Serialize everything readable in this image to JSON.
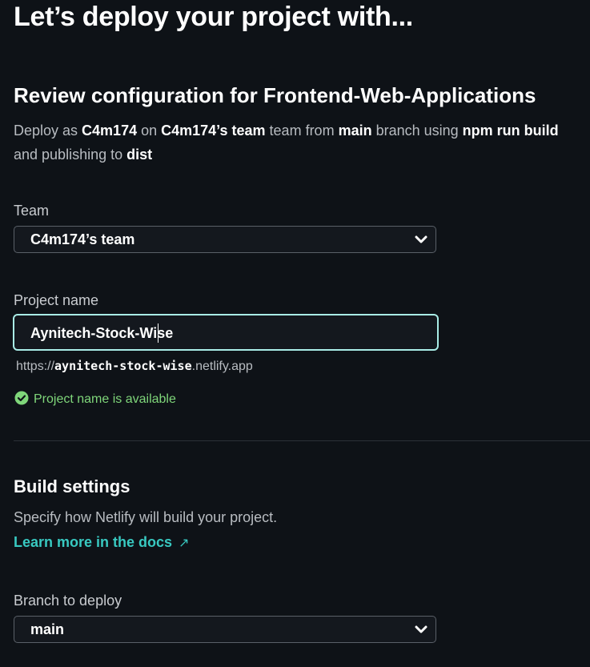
{
  "page_title": "Let’s deploy your project with...",
  "review": {
    "heading": "Review configuration for Frontend-Web-Applications",
    "deploy_as_prefix": "Deploy as ",
    "user": "C4m174",
    "on": " on ",
    "team_bold": "C4m174’s team",
    "team_suffix": " team from ",
    "branch_bold": "main",
    "branch_suffix": " branch using ",
    "command_bold": "npm run build",
    "line2_prefix": "and publishing to ",
    "publish_dir": "dist"
  },
  "team_field": {
    "label": "Team",
    "value": "C4m174’s team"
  },
  "project_field": {
    "label": "Project name",
    "value_left": "Aynitech-Stock-",
    "value_right": "Wise",
    "url_prefix": "https://",
    "url_slug": "aynitech-stock-wise",
    "url_suffix": ".netlify.app",
    "status": "Project name is available"
  },
  "build": {
    "heading": "Build settings",
    "description": "Specify how Netlify will build your project.",
    "link": "Learn more in the docs",
    "link_arrow": "↗"
  },
  "branch_field": {
    "label": "Branch to deploy",
    "value": "main"
  },
  "colors": {
    "background": "#0e1217",
    "accent_teal": "#38c9c1",
    "focus_border": "#a9ece6",
    "success_green": "#7fd67a"
  },
  "icons": [
    "chevron-down-icon",
    "check-circle-icon",
    "external-link-arrow-icon"
  ]
}
